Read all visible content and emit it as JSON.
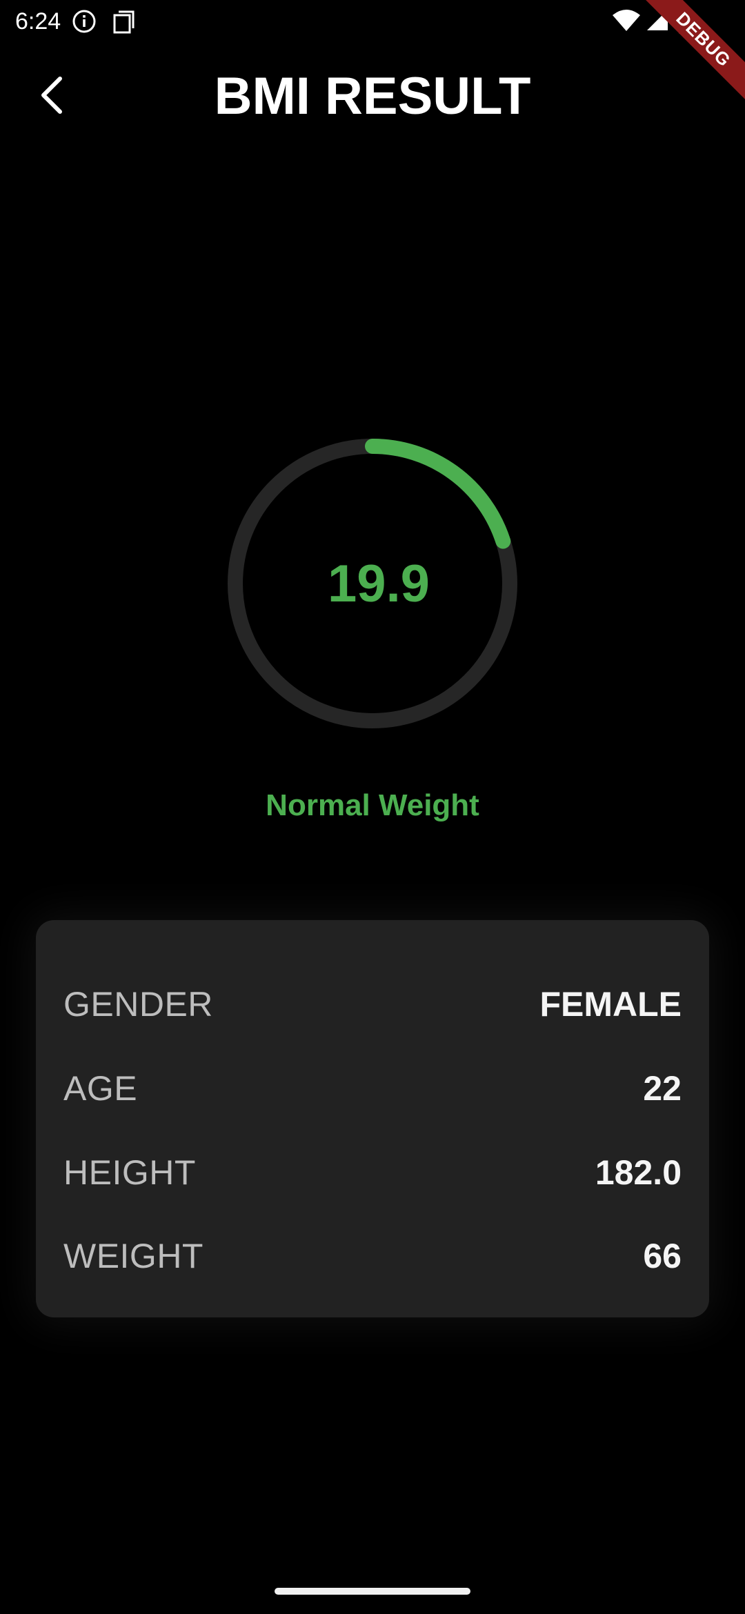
{
  "status_bar": {
    "time": "6:24",
    "icons": [
      "info-icon",
      "sim-card-icon",
      "wifi-icon",
      "signal-icon",
      "battery-icon"
    ]
  },
  "debug_banner": "DEBUG",
  "header": {
    "back_icon": "chevron-left-icon",
    "title": "BMI RESULT"
  },
  "result": {
    "bmi_value": "19.9",
    "gauge_fraction": 0.2,
    "category": "Normal Weight",
    "accent_color": "#4caf50",
    "track_color": "#262626"
  },
  "details": {
    "rows": [
      {
        "label": "GENDER",
        "value": "FEMALE"
      },
      {
        "label": "AGE",
        "value": "22"
      },
      {
        "label": "HEIGHT",
        "value": "182.0"
      },
      {
        "label": "WEIGHT",
        "value": "66"
      }
    ]
  }
}
